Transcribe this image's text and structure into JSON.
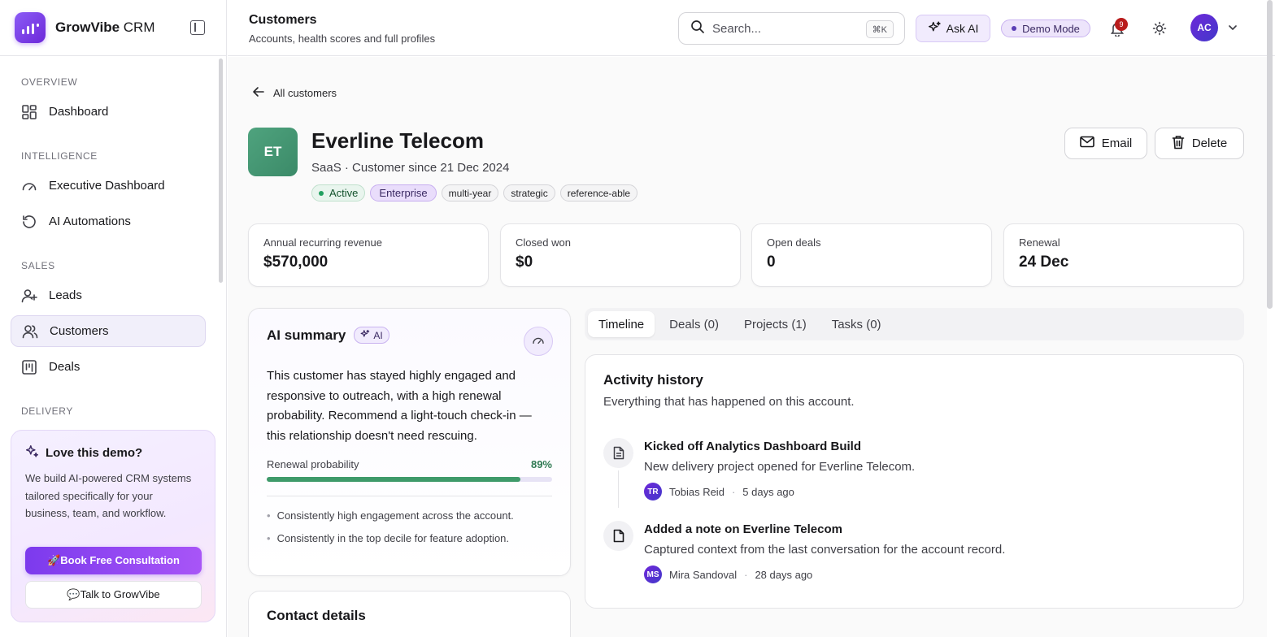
{
  "brand": {
    "name_bold": "GrowVibe",
    "name_rest": " CRM"
  },
  "sidebar": {
    "sections": [
      {
        "label": "OVERVIEW"
      },
      {
        "label": "INTELLIGENCE"
      },
      {
        "label": "SALES"
      },
      {
        "label": "DELIVERY"
      }
    ],
    "items": [
      {
        "label": "Dashboard",
        "icon": "dashboard-icon"
      },
      {
        "label": "Executive Dashboard",
        "icon": "gauge-icon"
      },
      {
        "label": "AI Automations",
        "icon": "refresh-icon"
      },
      {
        "label": "Leads",
        "icon": "user-plus-icon"
      },
      {
        "label": "Customers",
        "icon": "users-icon",
        "active": true
      },
      {
        "label": "Deals",
        "icon": "kanban-icon"
      }
    ],
    "promo": {
      "title": "Love this demo?",
      "text": "We build AI-powered CRM systems tailored specifically for your business, team, and workflow.",
      "book_label": "🚀Book Free Consultation",
      "talk_label": "💬Talk to GrowVibe"
    }
  },
  "header": {
    "title": "Customers",
    "subtitle": "Accounts, health scores and full profiles",
    "search_placeholder": "Search...",
    "search_shortcut": "⌘K",
    "ask_ai_label": "Ask AI",
    "demo_mode_label": "Demo Mode",
    "notification_count": "9",
    "user_initials": "AC"
  },
  "customer": {
    "back_label": "All customers",
    "initials": "ET",
    "name": "Everline Telecom",
    "subtitle": "SaaS · Customer since 21 Dec 2024",
    "status": "Active",
    "tier": "Enterprise",
    "tags": [
      "multi-year",
      "strategic",
      "reference-able"
    ],
    "email_label": "Email",
    "delete_label": "Delete"
  },
  "stats": [
    {
      "label": "Annual recurring revenue",
      "value": "$570,000"
    },
    {
      "label": "Closed won",
      "value": "$0"
    },
    {
      "label": "Open deals",
      "value": "0"
    },
    {
      "label": "Renewal",
      "value": "24 Dec"
    }
  ],
  "ai_summary": {
    "title": "AI summary",
    "badge": "AI",
    "body": "This customer has stayed highly engaged and responsive to outreach, with a high renewal probability. Recommend a light-touch check-in — this relationship doesn't need rescuing.",
    "renewal_label": "Renewal probability",
    "renewal_pct": "89%",
    "renewal_value": 0.89,
    "bullets": [
      "Consistently high engagement across the account.",
      "Consistently in the top decile for feature adoption."
    ]
  },
  "contact": {
    "title": "Contact details"
  },
  "tabs": [
    {
      "label": "Timeline",
      "selected": true
    },
    {
      "label": "Deals (0)"
    },
    {
      "label": "Projects (1)"
    },
    {
      "label": "Tasks (0)"
    }
  ],
  "activity": {
    "title": "Activity history",
    "subtitle": "Everything that has happened on this account.",
    "events": [
      {
        "icon": "document-icon",
        "title": "Kicked off Analytics Dashboard Build",
        "description": "New delivery project opened for Everline Telecom.",
        "author_initials": "TR",
        "author": "Tobias Reid",
        "time": "5 days ago"
      },
      {
        "icon": "note-icon",
        "title": "Added a note on Everline Telecom",
        "description": "Captured context from the last conversation for the account record.",
        "author_initials": "MS",
        "author": "Mira Sandoval",
        "time": "28 days ago"
      }
    ]
  }
}
